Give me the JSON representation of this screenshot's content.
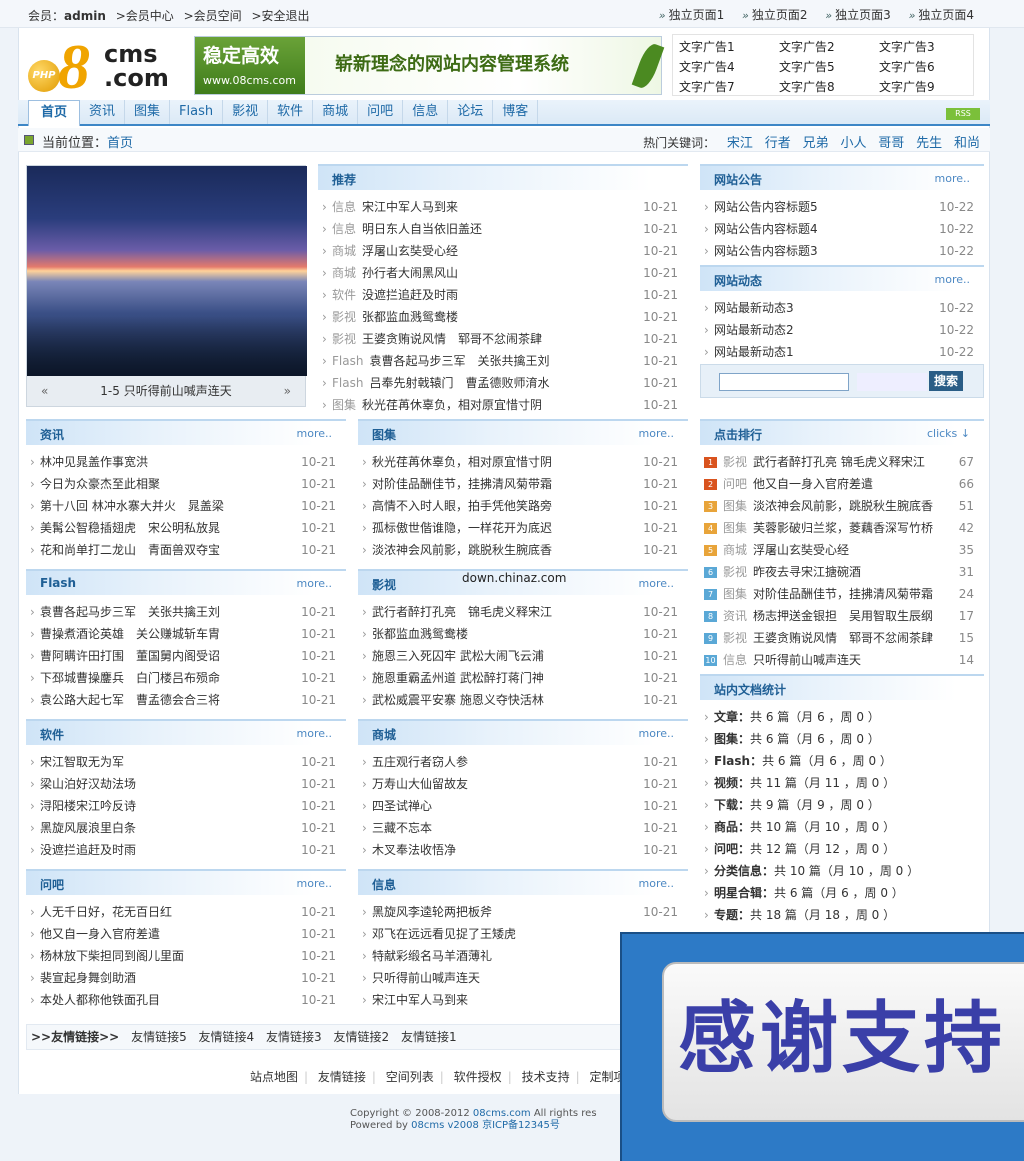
{
  "topbar": {
    "member_label": "会员：",
    "user": "admin",
    "links": [
      ">会员中心",
      ">会员空间",
      ">安全退出"
    ],
    "pages": [
      "独立页面1",
      "独立页面2",
      "独立页面3",
      "独立页面4"
    ]
  },
  "logo": {
    "php": "PHP",
    "eight": "8",
    "cms": "cms",
    ".com": ".com"
  },
  "banner": {
    "title": "稳定高效",
    "url": "www.08cms.com",
    "slogan": "崭新理念的网站内容管理系统"
  },
  "text_ads": [
    "文字广告1",
    "文字广告2",
    "文字广告3",
    "文字广告4",
    "文字广告5",
    "文字广告6",
    "文字广告7",
    "文字广告8",
    "文字广告9"
  ],
  "nav": {
    "items": [
      "首页",
      "资讯",
      "图集",
      "Flash",
      "影视",
      "软件",
      "商城",
      "问吧",
      "信息",
      "论坛",
      "博客"
    ],
    "rss": "RSS"
  },
  "crumb": {
    "label": "当前位置：",
    "home": "首页",
    "hot_label": "热门关键词：",
    "keywords": [
      "宋江",
      "行者",
      "兄弟",
      "小人",
      "哥哥",
      "先生",
      "和尚"
    ]
  },
  "photo": {
    "caption": "1-5 只听得前山喊声连天",
    "prev": "«",
    "next": "»"
  },
  "recommend": {
    "title": "推荐",
    "items": [
      {
        "cat": "信息",
        "title": "宋江中军人马到来",
        "date": "10-21"
      },
      {
        "cat": "信息",
        "title": "明日东人自当依旧盖还",
        "date": "10-21"
      },
      {
        "cat": "商城",
        "title": "浮屠山玄奘受心经",
        "date": "10-21"
      },
      {
        "cat": "商城",
        "title": "孙行者大闹黑风山",
        "date": "10-21"
      },
      {
        "cat": "软件",
        "title": "没遮拦追赶及时雨",
        "date": "10-21"
      },
      {
        "cat": "影视",
        "title": "张都监血溅鸳鸯楼",
        "date": "10-21"
      },
      {
        "cat": "影视",
        "title": "王婆贪贿说风情　郓哥不忿闹茶肆",
        "date": "10-21"
      },
      {
        "cat": "Flash",
        "title": "袁曹各起马步三军　关张共擒王刘",
        "date": "10-21"
      },
      {
        "cat": "Flash",
        "title": "吕奉先射戟辕门　曹孟德败师淯水",
        "date": "10-21"
      },
      {
        "cat": "图集",
        "title": "秋光荏苒休辜负，相对原宜惜寸阴",
        "date": "10-21"
      }
    ]
  },
  "sections": [
    {
      "title": "资讯",
      "more": "more..",
      "items": [
        {
          "title": "林冲见晁盖作事宽洪",
          "date": "10-21"
        },
        {
          "title": "今日为众豪杰至此相聚",
          "date": "10-21"
        },
        {
          "title": "第十八回 林冲水寨大并火　晁盖梁",
          "date": "10-21"
        },
        {
          "title": "美髯公智稳插翅虎　宋公明私放晁",
          "date": "10-21"
        },
        {
          "title": "花和尚单打二龙山　青面兽双夺宝",
          "date": "10-21"
        }
      ]
    },
    {
      "title": "图集",
      "more": "more..",
      "items": [
        {
          "title": "秋光荏苒休辜负，相对原宜惜寸阴",
          "date": "10-21"
        },
        {
          "title": "对阶佳品酬佳节，挂拂清风菊带霜",
          "date": "10-21"
        },
        {
          "title": "高情不入时人眼，拍手凭他笑路旁",
          "date": "10-21"
        },
        {
          "title": "孤标傲世偕谁隐，一样花开为底迟",
          "date": "10-21"
        },
        {
          "title": "淡浓神会风前影，跳脱秋生腕底香",
          "date": "10-21"
        }
      ]
    },
    {
      "title": "Flash",
      "more": "more..",
      "items": [
        {
          "title": "袁曹各起马步三军　关张共擒王刘",
          "date": "10-21"
        },
        {
          "title": "曹操煮酒论英雄　关公赚城斩车胄",
          "date": "10-21"
        },
        {
          "title": "曹阿瞒许田打围　董国舅内阁受诏",
          "date": "10-21"
        },
        {
          "title": "下邳城曹操鏖兵　白门楼吕布殒命",
          "date": "10-21"
        },
        {
          "title": "袁公路大起七军　曹孟德会合三将",
          "date": "10-21"
        }
      ]
    },
    {
      "title": "影视",
      "more": "more..",
      "items": [
        {
          "title": "武行者醉打孔亮　锦毛虎义释宋江",
          "date": "10-21"
        },
        {
          "title": "张都监血溅鸳鸯楼",
          "date": "10-21"
        },
        {
          "title": "施恩三入死囚牢 武松大闹飞云浦",
          "date": "10-21"
        },
        {
          "title": "施恩重霸孟州道 武松醉打蒋门神",
          "date": "10-21"
        },
        {
          "title": "武松威震平安寨 施恩义夺快活林",
          "date": "10-21"
        }
      ]
    },
    {
      "title": "软件",
      "more": "more..",
      "items": [
        {
          "title": "宋江智取无为军",
          "date": "10-21"
        },
        {
          "title": "梁山泊好汉劫法场",
          "date": "10-21"
        },
        {
          "title": "浔阳楼宋江吟反诗",
          "date": "10-21"
        },
        {
          "title": "黑旋风展浪里白条",
          "date": "10-21"
        },
        {
          "title": "没遮拦追赶及时雨",
          "date": "10-21"
        }
      ]
    },
    {
      "title": "商城",
      "more": "more..",
      "items": [
        {
          "title": "五庄观行者窃人参",
          "date": "10-21"
        },
        {
          "title": "万寿山大仙留故友",
          "date": "10-21"
        },
        {
          "title": "四圣试禅心",
          "date": "10-21"
        },
        {
          "title": "三藏不忘本",
          "date": "10-21"
        },
        {
          "title": "木叉奉法收悟净",
          "date": "10-21"
        }
      ]
    },
    {
      "title": "问吧",
      "more": "more..",
      "items": [
        {
          "title": "人无千日好，花无百日红",
          "date": "10-21"
        },
        {
          "title": "他又自一身入官府差遣",
          "date": "10-21"
        },
        {
          "title": "杨林放下柴担同到阁儿里面",
          "date": "10-21"
        },
        {
          "title": "裴宣起身舞剑助酒",
          "date": "10-21"
        },
        {
          "title": "本处人都称他铁面孔目",
          "date": "10-21"
        }
      ]
    },
    {
      "title": "信息",
      "more": "more..",
      "items": [
        {
          "title": "黑旋风李逵轮两把板斧",
          "date": "10-21"
        },
        {
          "title": "邓飞在远远看见捉了王矮虎",
          "date": ""
        },
        {
          "title": "特献彩缎名马羊酒薄礼",
          "date": ""
        },
        {
          "title": "只听得前山喊声连天",
          "date": ""
        },
        {
          "title": "宋江中军人马到来",
          "date": ""
        }
      ]
    }
  ],
  "notice": {
    "title": "网站公告",
    "more": "more..",
    "items": [
      {
        "title": "网站公告内容标题5",
        "date": "10-22"
      },
      {
        "title": "网站公告内容标题4",
        "date": "10-22"
      },
      {
        "title": "网站公告内容标题3",
        "date": "10-22"
      }
    ]
  },
  "news": {
    "title": "网站动态",
    "more": "more..",
    "items": [
      {
        "title": "网站最新动态3",
        "date": "10-22"
      },
      {
        "title": "网站最新动态2",
        "date": "10-22"
      },
      {
        "title": "网站最新动态1",
        "date": "10-22"
      }
    ]
  },
  "search": {
    "button": "搜索"
  },
  "ranking": {
    "title": "点击排行",
    "more": "clicks ↓",
    "items": [
      {
        "n": "1",
        "color": "#d9531e",
        "cat": "影视",
        "title": "武行者醉打孔亮 锦毛虎义释宋江",
        "clicks": "67"
      },
      {
        "n": "2",
        "color": "#d9531e",
        "cat": "问吧",
        "title": "他又自一身入官府差遣",
        "clicks": "66"
      },
      {
        "n": "3",
        "color": "#e8a43a",
        "cat": "图集",
        "title": "淡浓神会风前影，跳脱秋生腕底香",
        "clicks": "51"
      },
      {
        "n": "4",
        "color": "#e8a43a",
        "cat": "图集",
        "title": "芙蓉影破归兰浆，菱藕香深写竹桥",
        "clicks": "42"
      },
      {
        "n": "5",
        "color": "#e8a43a",
        "cat": "商城",
        "title": "浮屠山玄奘受心经",
        "clicks": "35"
      },
      {
        "n": "6",
        "color": "#5aa8d6",
        "cat": "影视",
        "title": "昨夜去寻宋江搪碗酒",
        "clicks": "31"
      },
      {
        "n": "7",
        "color": "#5aa8d6",
        "cat": "图集",
        "title": "对阶佳品酬佳节，挂拂清风菊带霜",
        "clicks": "24"
      },
      {
        "n": "8",
        "color": "#5aa8d6",
        "cat": "资讯",
        "title": "杨志押送金银担　吴用智取生辰纲",
        "clicks": "17"
      },
      {
        "n": "9",
        "color": "#5aa8d6",
        "cat": "影视",
        "title": "王婆贪贿说风情　郓哥不忿闹茶肆",
        "clicks": "15"
      },
      {
        "n": "10",
        "color": "#5aa8d6",
        "cat": "信息",
        "title": "只听得前山喊声连天",
        "clicks": "14"
      }
    ]
  },
  "stats": {
    "title": "站内文档统计",
    "items": [
      {
        "k": "文章：",
        "v": "共 6 篇（月 6 ，周 0 ）"
      },
      {
        "k": "图集：",
        "v": "共 6 篇（月 6 ，周 0 ）"
      },
      {
        "k": "Flash：",
        "v": "共 6 篇（月 6 ，周 0 ）"
      },
      {
        "k": "视频：",
        "v": "共 11 篇（月 11 ，周 0 ）"
      },
      {
        "k": "下载：",
        "v": "共 9 篇（月 9 ，周 0 ）"
      },
      {
        "k": "商品：",
        "v": "共 10 篇（月 10 ，周 0 ）"
      },
      {
        "k": "问吧：",
        "v": "共 12 篇（月 12 ，周 0 ）"
      },
      {
        "k": "分类信息：",
        "v": "共 10 篇（月 10 ，周 0 ）"
      },
      {
        "k": "明星合辑：",
        "v": "共 6 篇（月 6 ，周 0 ）"
      },
      {
        "k": "专题：",
        "v": "共 18 篇（月 18 ，周 0 ）"
      }
    ]
  },
  "watermark": "down.chinaz.com",
  "links": {
    "label": ">>友情链接>>",
    "items": [
      "友情链接5",
      "友情链接4",
      "友情链接3",
      "友情链接2",
      "友情链接1"
    ]
  },
  "footer": {
    "nav": [
      "站点地图",
      "友情链接",
      "空间列表",
      "软件授权",
      "技术支持",
      "定制项目"
    ],
    "copyright": "Copyright © 2008-2012",
    "site": "08cms.com",
    "rights": "All rights res",
    "powered": "Powered by",
    "brand": "08cms v2008",
    "icp": "京ICP备12345号"
  },
  "overlay": {
    "text": "感谢支持"
  }
}
